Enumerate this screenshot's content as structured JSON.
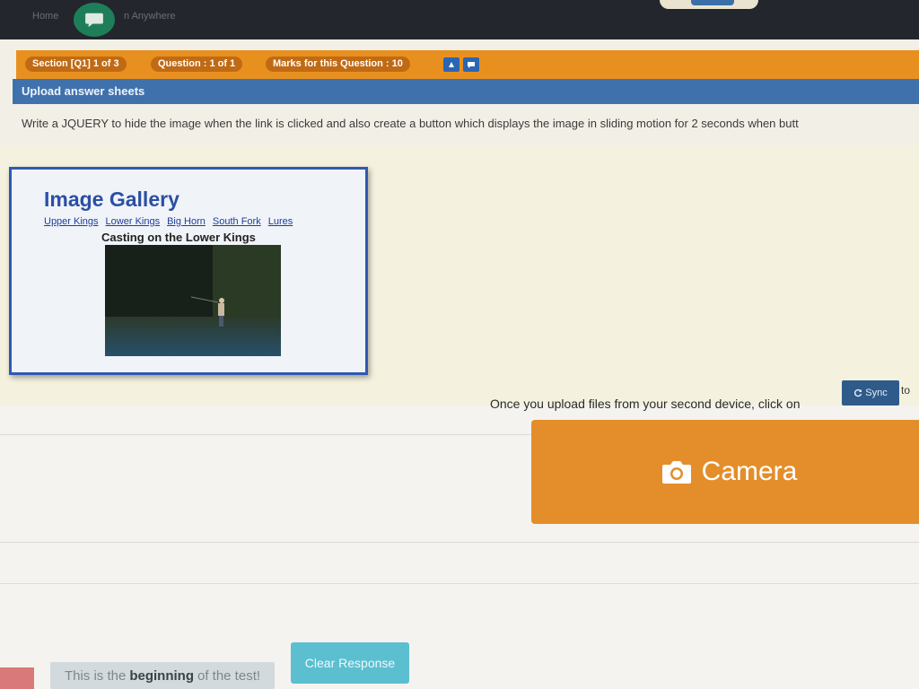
{
  "topbar": {
    "left_text": "Home",
    "anywhere_text": "n Anywhere"
  },
  "header": {
    "section": "Section [Q1] 1 of 3",
    "question": "Question : 1 of 1",
    "marks": "Marks for this Question : 10"
  },
  "panel": {
    "title": "Upload answer sheets",
    "question_text": "Write a JQUERY to hide the image when the link is clicked and also create a button which displays the image in sliding motion for 2 seconds when butt"
  },
  "gallery": {
    "title": "Image Gallery",
    "links": [
      "Upper Kings",
      "Lower Kings",
      "Big Horn",
      "South Fork",
      "Lures"
    ],
    "caption": "Casting on the Lower Kings"
  },
  "upload": {
    "sync_text": "Once you upload files from your second device, click on",
    "sync_label": "Sync",
    "after_sync": "to",
    "camera_label": "Camera"
  },
  "footer": {
    "begin_pre": "This is the",
    "begin_bold": "beginning",
    "begin_post": "of the test!",
    "clear_label": "Clear Response"
  },
  "colors": {
    "orange": "#e8901f",
    "blue": "#3f72ad",
    "camera": "#e48e2b",
    "clear": "#5bbfd0"
  },
  "icons": [
    "chat-icon",
    "question-icon",
    "comment-icon",
    "sync-icon",
    "camera-icon"
  ]
}
